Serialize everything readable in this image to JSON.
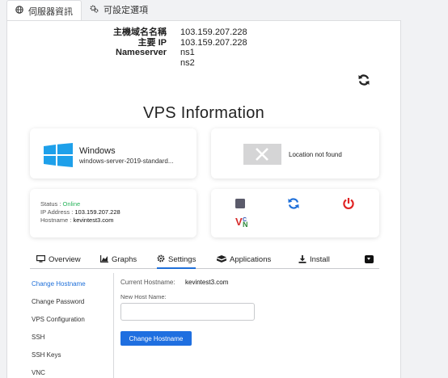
{
  "tabs": [
    {
      "label": "伺服器資訊",
      "icon": "globe-icon",
      "active": true
    },
    {
      "label": "可設定選項",
      "icon": "cogs-icon",
      "active": false
    }
  ],
  "server_info": [
    {
      "label": "主機域名名稱",
      "value": "103.159.207.228"
    },
    {
      "label": "主要 IP",
      "value": "103.159.207.228"
    },
    {
      "label": "Nameserver",
      "value": "ns1"
    },
    {
      "label": "",
      "value": "ns2"
    }
  ],
  "vps_title": "VPS Information",
  "os": {
    "name": "Windows",
    "version": "windows-server-2019-standard..."
  },
  "location": {
    "text": "Location not found"
  },
  "status": {
    "status_label": "Status : ",
    "status_value": "Online",
    "ip_label": "IP Address : ",
    "ip_value": "103.159.207.228",
    "hostname_label": "Hostname : ",
    "hostname_value": "kevintest3.com"
  },
  "controls": [
    "stop-square-icon",
    "reboot-icon",
    "power-icon",
    "vnc-icon"
  ],
  "subtabs": [
    {
      "label": "Overview",
      "icon": "monitor-icon",
      "active": false
    },
    {
      "label": "Graphs",
      "icon": "chart-icon",
      "active": false
    },
    {
      "label": "Settings",
      "icon": "gear-icon",
      "active": true
    },
    {
      "label": "Applications",
      "icon": "apps-icon",
      "active": false
    },
    {
      "label": "Install",
      "icon": "download-icon",
      "active": false
    }
  ],
  "side_menu": [
    "Change Hostname",
    "Change Password",
    "VPS Configuration",
    "SSH",
    "SSH Keys",
    "VNC"
  ],
  "settings": {
    "current_label": "Current Hostname:",
    "current_value": "kevintest3.com",
    "new_label": "New Host Name:",
    "input_value": "",
    "button_label": "Change Hostname"
  },
  "colors": {
    "accent": "#1e6fd9",
    "online": "#27b35a",
    "power": "#e02424"
  }
}
